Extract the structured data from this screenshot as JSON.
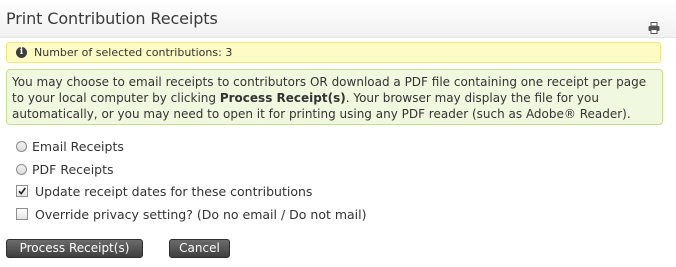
{
  "header": {
    "title": "Print Contribution Receipts",
    "print_icon": "printer-icon"
  },
  "status": {
    "icon": "info-icon",
    "text": "Number of selected contributions: 3"
  },
  "help": {
    "text_before": "You may choose to email receipts to contributors OR download a PDF file containing one receipt per page to your local computer by clicking ",
    "bold": "Process Receipt(s)",
    "text_after": ". Your browser may display the file for you automatically, or you may need to open it for printing using any PDF reader (such as Adobe® Reader)."
  },
  "options": {
    "email_label": "Email Receipts",
    "email_selected": false,
    "pdf_label": "PDF Receipts",
    "pdf_selected": false,
    "update_dates_label": "Update receipt dates for these contributions",
    "update_dates_checked": true,
    "override_privacy_label": "Override privacy setting? (Do no email / Do not mail)",
    "override_privacy_checked": false
  },
  "buttons": {
    "process_label": "Process Receipt(s)",
    "cancel_label": "Cancel"
  }
}
